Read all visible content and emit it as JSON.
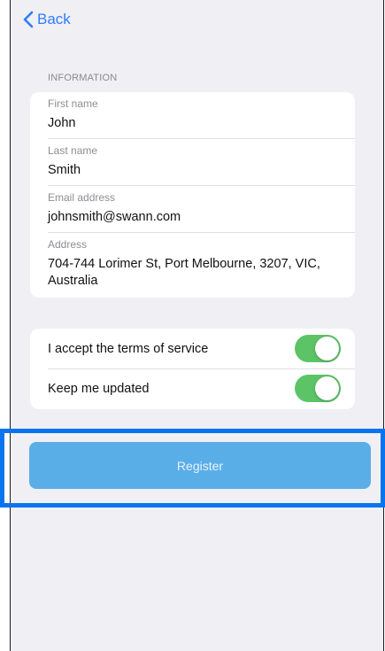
{
  "nav": {
    "back_label": "Back"
  },
  "information": {
    "section_title": "INFORMATION",
    "fields": [
      {
        "label": "First name",
        "value": "John"
      },
      {
        "label": "Last name",
        "value": "Smith"
      },
      {
        "label": "Email address",
        "value": "johnsmith@swann.com"
      },
      {
        "label": "Address",
        "value": "704-744 Lorimer St, Port Melbourne, 3207, VIC, Australia"
      }
    ]
  },
  "toggles": [
    {
      "label": "I accept the terms of service",
      "on": true
    },
    {
      "label": "Keep me updated",
      "on": true
    }
  ],
  "register": {
    "label": "Register"
  },
  "colors": {
    "accent": "#2f7cf6",
    "toggle_on": "#5cc466",
    "button": "#5aaee8",
    "highlight": "#0a74f0",
    "background": "#f0eff4"
  }
}
